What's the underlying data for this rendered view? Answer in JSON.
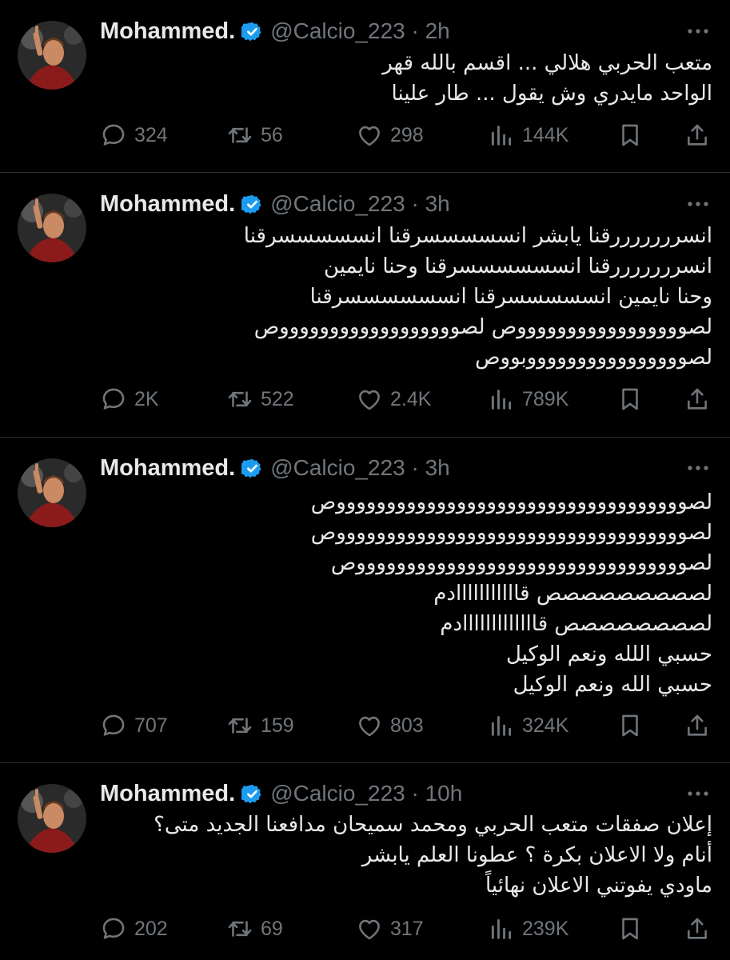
{
  "colors": {
    "background": "#000000",
    "text": "#e7e9ea",
    "muted": "#71767b",
    "divider": "#2f3336",
    "verified": "#1d9bf0"
  },
  "icons": {
    "reply": "speech-bubble-icon",
    "retweet": "retweet-icon",
    "like": "heart-icon",
    "views": "bar-chart-icon",
    "bookmark": "bookmark-icon",
    "share": "share-icon",
    "more": "more-dots-icon",
    "verified": "verified-badge-icon"
  },
  "tweets": [
    {
      "name": "Mohammed.",
      "handle_time": "@Calcio_223 · 2h",
      "lines": [
        "متعب الحربي هلالي ... اقسم بالله قهر",
        "الواحد مايدري وش يقول ... طار علينا"
      ],
      "replies": "324",
      "retweets": "56",
      "likes": "298",
      "views": "144K"
    },
    {
      "name": "Mohammed.",
      "handle_time": "@Calcio_223 · 3h",
      "lines": [
        "انسرررررررقنا يابشر انسسسسسرقنا انسسسسسرقنا",
        "انسرررررررقنا انسسسسسسرقنا وحنا نايمين",
        "وحنا نايمين انسسسسسرقنا انسسسسسسرقنا",
        "لصوووووووووووووووووص لصووووووووووووووووووص",
        "لصووووووووووووووووبووص"
      ],
      "replies": "2K",
      "retweets": "522",
      "likes": "2.4K",
      "views": "789K"
    },
    {
      "name": "Mohammed.",
      "handle_time": "@Calcio_223 · 3h",
      "lines": [
        "لصوووووووووووووووووووووووووووووووووووص",
        "لصوووووووووووووووووووووووووووووووووووص",
        "لصوووووووووووووووووووووووووووووووووص",
        "لصصصصصصصصص قااااااااااادم",
        "لصصصصصصصص قااااااااااااادم",
        "حسبي اللله ونعم الوكيل",
        "حسبي الله ونعم الوكيل"
      ],
      "replies": "707",
      "retweets": "159",
      "likes": "803",
      "views": "324K"
    },
    {
      "name": "Mohammed.",
      "handle_time": "@Calcio_223 · 10h",
      "lines": [
        "إعلان صفقات متعب الحربي ومحمد سميحان مدافعنا الجديد متى؟",
        "أنام ولا الاعلان بكرة ؟ عطونا العلم يابشر",
        "ماودي يفوتني الاعلان نهائياً"
      ],
      "replies": "202",
      "retweets": "69",
      "likes": "317",
      "views": "239K"
    }
  ]
}
